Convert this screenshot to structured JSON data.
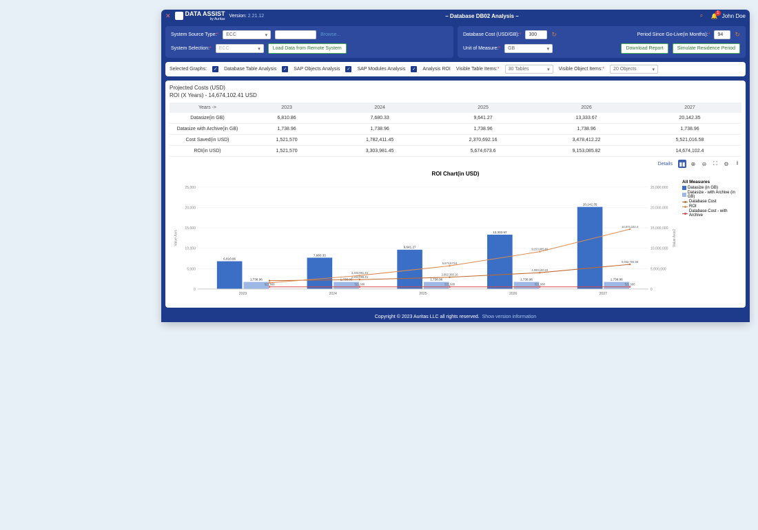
{
  "header": {
    "brand": "DATA ASSIST",
    "brand_sub": "by Auritas",
    "version_label": "Version:",
    "version": "2.21.12",
    "title": "– Database DB02 Analysis –",
    "user": "John Doe",
    "notif_count": "1"
  },
  "panel_left": {
    "source_type_label": "System Source Type:",
    "source_type_value": "ECC",
    "selection_label": "System Selection:",
    "selection_value": "ECC",
    "browse": "Browse...",
    "load_btn": "Load Data from Remote System"
  },
  "panel_right": {
    "db_cost_label": "Database Cost (USD/GB):",
    "db_cost_value": "300",
    "period_label": "Period Since Go-Live(in Months):",
    "period_value": "94",
    "uom_label": "Unit of Measure:",
    "uom_value": "GB",
    "download_btn": "Download Report",
    "simulate_btn": "Simulate Residence Period"
  },
  "graph_bar": {
    "selected_label": "Selected Graphs:",
    "opts": [
      "Database Table Analysis",
      "SAP Objects Analysis",
      "SAP Modules Analysis",
      "Analysis ROI"
    ],
    "vti_label": "Visible Table Items:",
    "vti_value": "30 Tables",
    "voi_label": "Visible Object Items:",
    "voi_value": "20 Objects"
  },
  "content_header": {
    "title": "Projected Costs (USD)",
    "roi_line": "ROI (X Years) - 14,674,102.41 USD"
  },
  "table": {
    "years_label": "Years ->",
    "years": [
      "2023",
      "2024",
      "2025",
      "2026",
      "2027"
    ],
    "rows": [
      {
        "label": "Datasize(in GB)",
        "v": [
          "6,810.86",
          "7,680.33",
          "9,641.27",
          "13,333.67",
          "20,142.35"
        ]
      },
      {
        "label": "Datasize with Archive(in GB)",
        "v": [
          "1,738.96",
          "1,738.96",
          "1,738.96",
          "1,738.96",
          "1,738.96"
        ]
      },
      {
        "label": "Cost Saved(in USD)",
        "v": [
          "1,521,570",
          "1,782,411.45",
          "2,370,692.16",
          "3,478,412.22",
          "5,521,016.58"
        ]
      },
      {
        "label": "ROI(in USD)",
        "v": [
          "1,521,570",
          "3,303,981.45",
          "5,674,673.6",
          "9,153,085.82",
          "14,674,102.4"
        ]
      }
    ]
  },
  "chart": {
    "title": "ROI Chart(in USD)",
    "details": "Details",
    "legend_title": "All Measures",
    "legend": [
      {
        "name": "Datasize (in GB)",
        "color": "#3a6fc5",
        "type": "sq"
      },
      {
        "name": "Datasize - with Archive (in GB)",
        "color": "#9db8e4",
        "type": "sq"
      },
      {
        "name": "Database Cost",
        "color": "#c46a2e",
        "type": "line"
      },
      {
        "name": "ROI",
        "color": "#e08a4f",
        "type": "line"
      },
      {
        "name": "Database Cost - with Archive",
        "color": "#d94848",
        "type": "line"
      }
    ],
    "yaxis_left_label": "Value Axis",
    "yaxis_right_label": "Value Axis2"
  },
  "chart_data": {
    "type": "bar",
    "categories": [
      "2023",
      "2024",
      "2025",
      "2026",
      "2027"
    ],
    "series": [
      {
        "name": "Datasize (in GB)",
        "values": [
          6810.86,
          7680.33,
          9641.27,
          13333.67,
          20142.35
        ],
        "color": "#3a6fc5"
      },
      {
        "name": "Datasize - with Archive (in GB)",
        "values": [
          1738.96,
          1738.96,
          1738.96,
          1738.96,
          1738.96
        ],
        "color": "#9db8e4"
      }
    ],
    "lines": [
      {
        "name": "Database Cost",
        "values": [
          2043258,
          2304099.45,
          2892380.16,
          4000100.22,
          6042704.58
        ],
        "labels": [
          "",
          "2,304,099.45",
          "2,892,380.16",
          "4,000,100.22",
          "6,042,704.58"
        ],
        "color": "#c46a2e"
      },
      {
        "name": "ROI",
        "values": [
          1521570,
          3303981.45,
          5674673.6,
          9153085.82,
          14674102.4
        ],
        "labels": [
          "",
          "3,303,981.45",
          "5,674,673.6",
          "9,153,085.82",
          "14,674,102.4"
        ],
        "color": "#e08a4f"
      },
      {
        "name": "Database Cost - with Archive",
        "values": [
          521688,
          521688,
          521688,
          521688,
          521688
        ],
        "labels": [
          "521,688",
          "521,688",
          "521,688",
          "521,688",
          "521,688"
        ],
        "color": "#d94848"
      }
    ],
    "ylim_left": [
      0,
      25000
    ],
    "yticks_left": [
      0,
      5000,
      10000,
      15000,
      20000,
      25000
    ],
    "ylim_right": [
      0,
      25000000
    ],
    "yticks_right": [
      0,
      5000000,
      10000000,
      15000000,
      20000000,
      25000000
    ]
  },
  "footer": {
    "text": "Copyright © 2023 Auritas LLC all rights reserved.",
    "link": "Show version information"
  }
}
